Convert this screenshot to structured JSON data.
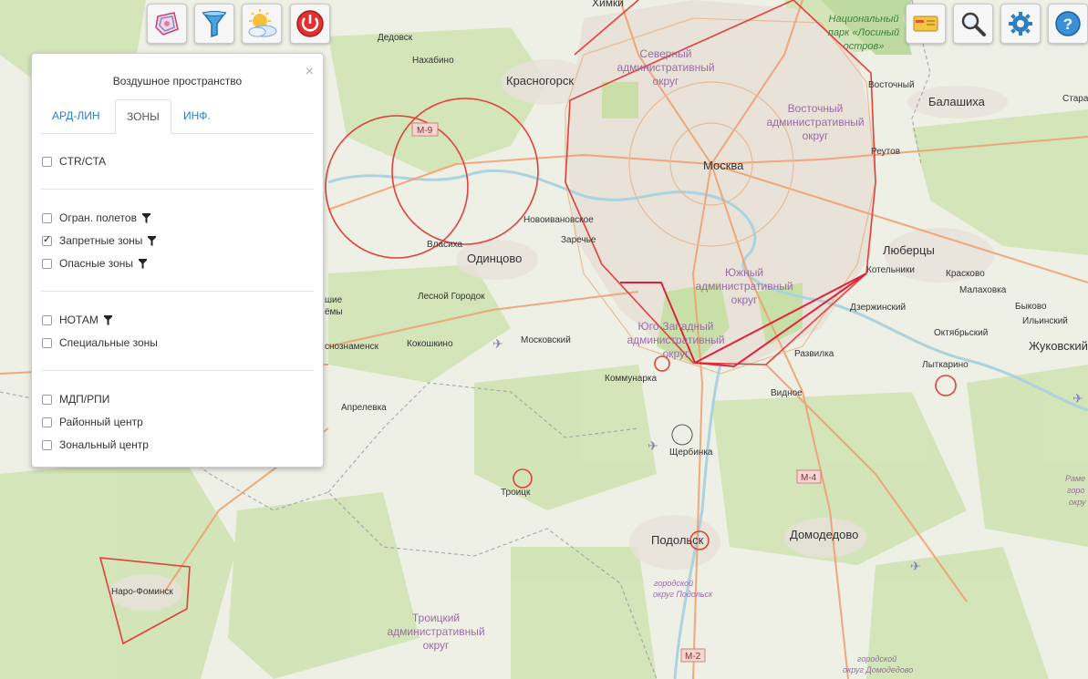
{
  "toolbar_left": [
    {
      "icon": "airspace-icon"
    },
    {
      "icon": "filter-icon"
    },
    {
      "icon": "weather-icon"
    },
    {
      "icon": "power-icon"
    }
  ],
  "toolbar_right": [
    {
      "icon": "ticket-icon"
    },
    {
      "icon": "search-icon"
    },
    {
      "icon": "gear-icon"
    },
    {
      "icon": "help-icon"
    }
  ],
  "panel": {
    "title": "Воздушное пространство",
    "close": "×",
    "tabs": [
      {
        "label": "АРД-ЛИН"
      },
      {
        "label": "ЗОНЫ",
        "active": true
      },
      {
        "label": "ИНФ."
      }
    ],
    "groups": [
      [
        {
          "label": "CTR/CTA",
          "checked": false,
          "filter": false
        }
      ],
      [
        {
          "label": "Огран. полетов",
          "checked": false,
          "filter": true
        },
        {
          "label": "Запретные зоны",
          "checked": true,
          "filter": true
        },
        {
          "label": "Опасные зоны",
          "checked": false,
          "filter": true
        }
      ],
      [
        {
          "label": "НОТАМ",
          "checked": false,
          "filter": true
        },
        {
          "label": "Специальные зоны",
          "checked": false,
          "filter": false
        }
      ],
      [
        {
          "label": "МДП/РПИ",
          "checked": false,
          "filter": false
        },
        {
          "label": "Районный центр",
          "checked": false,
          "filter": false
        },
        {
          "label": "Зональный центр",
          "checked": false,
          "filter": false
        }
      ]
    ]
  },
  "map": {
    "labels": {
      "himki": "Химки",
      "dedovsk": "Дедовск",
      "nahabino": "Нахабино",
      "krasnogorsk": "Красногорск",
      "sever1": "Северный",
      "sever2": "административный",
      "sever3": "округ",
      "np1": "Национальный",
      "np2": "парк «Лосиный",
      "np3": "остров»",
      "vostochny": "Восточный",
      "balashiha": "Балашиха",
      "starye": "Старая",
      "vost1": "Восточный",
      "vost2": "административный",
      "vost3": "округ",
      "moskva": "Москва",
      "reutov": "Реутов",
      "lyubertsy": "Люберцы",
      "kotelniki": "Котельники",
      "kraskovo": "Красково",
      "malahovka": "Малаховка",
      "bykovo": "Быково",
      "ilinsky": "Ильинский",
      "dzerzh": "Дзержинский",
      "oktyabr": "Октябрьский",
      "zhukovsky": "Жуковский",
      "lytkarino": "Лыткарино",
      "novoivan": "Новоивановское",
      "zarechie": "Заречье",
      "vlasiha": "Власиха",
      "odintsovo": "Одинцово",
      "lesnoy": "Лесной Городок",
      "kokoshkino": "Кокошкино",
      "moskovsky": "Московский",
      "snoznamensk": "снознаменск",
      "shie": "шие",
      "yomy": "ёмы",
      "aprelevka": "Апрелевка",
      "kommunarka": "Коммунарка",
      "yug1": "Южный",
      "yug2": "административный",
      "yug3": "округ",
      "yz1": "Юго-Западный",
      "yz2": "административный",
      "yz3": "округ",
      "razvilka": "Развилка",
      "vidnoe": "Видное",
      "shcherbinka": "Щербинка",
      "troitsk": "Троицк",
      "podolsk": "Подольск",
      "gopod1": "городской",
      "gopod2": "округ Подольск",
      "domodedovo": "Домодедово",
      "godom1": "городской",
      "godom2": "округ Домодедово",
      "naro": "Наро-Фоминск",
      "tr1": "Троицкий",
      "tr2": "административный",
      "tr3": "округ",
      "rame1": "Раме",
      "rame2": "горо",
      "rame3": "окру",
      "m9": "М-9",
      "m4": "М-4",
      "m2": "М-2"
    }
  },
  "colors": {
    "zone_red": "#e0403c",
    "water": "#aad3df",
    "park": "#c8e0a8",
    "urban": "#e8e2d9",
    "road": "#f0a070"
  }
}
